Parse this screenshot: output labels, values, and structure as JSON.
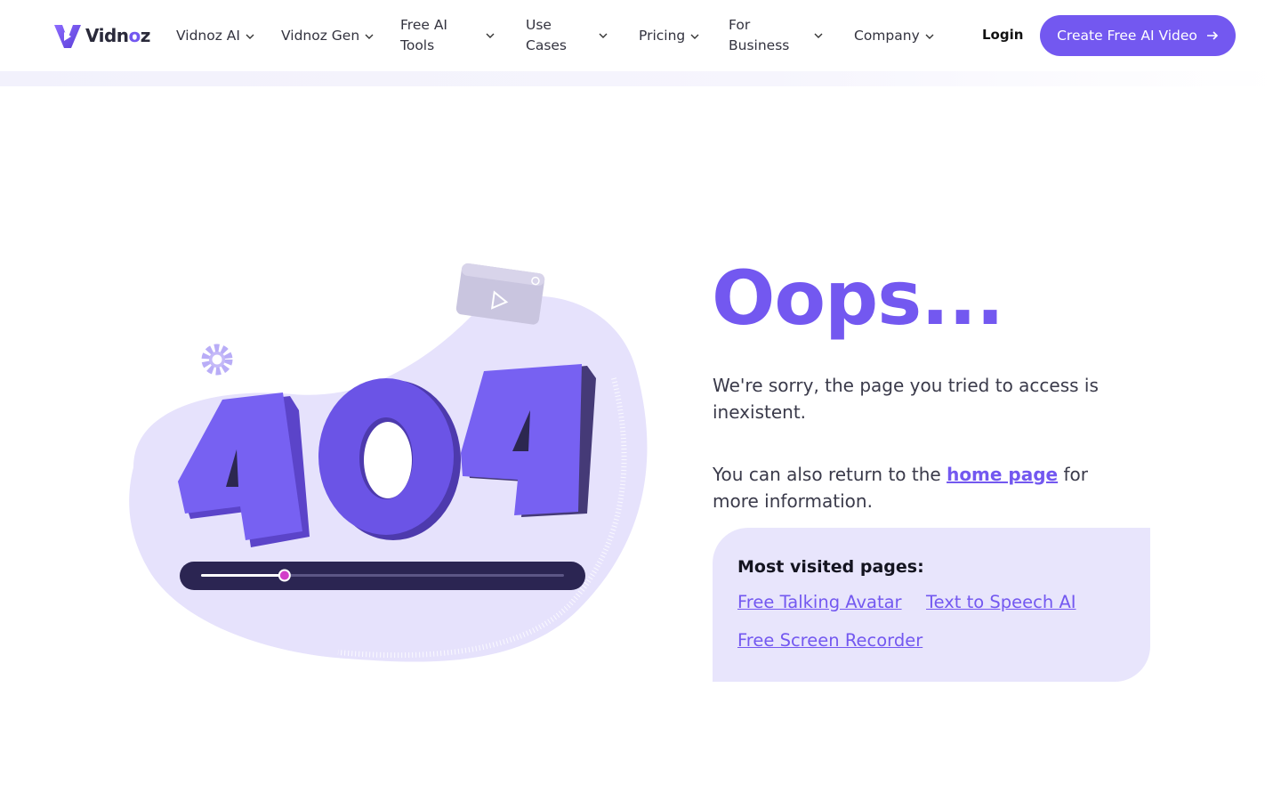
{
  "brand": {
    "name_prefix": "Vidn",
    "name_o": "o",
    "name_suffix": "z",
    "accent": "#7358f0"
  },
  "nav": {
    "items": [
      {
        "label": "Vidnoz AI",
        "icon": "chevron-down-icon"
      },
      {
        "label": "Vidnoz Gen",
        "icon": "chevron-down-icon"
      },
      {
        "label_line1": "Free AI",
        "label_line2": "Tools",
        "icon": "chevron-down-icon"
      },
      {
        "label_line1": "Use",
        "label_line2": "Cases",
        "icon": "chevron-down-icon"
      },
      {
        "label": "Pricing",
        "icon": "chevron-down-icon"
      },
      {
        "label_line1": "For",
        "label_line2": "Business",
        "icon": "chevron-down-icon"
      },
      {
        "label": "Company",
        "icon": "chevron-down-icon"
      }
    ],
    "login": "Login",
    "cta": "Create Free AI Video",
    "cta_icon": "arrow-right-icon"
  },
  "illustration": {
    "digits": "404",
    "video_progress": 0.23
  },
  "content": {
    "title": "Oops...",
    "sorry": "We're sorry, the page you tried to access is inexistent.",
    "return_before": "You can also return to the ",
    "home_link": "home page",
    "return_after": " for more information."
  },
  "visited": {
    "heading": "Most visited pages:",
    "links": [
      "Free Talking Avatar",
      "Text to Speech AI",
      "Free Screen Recorder"
    ]
  }
}
